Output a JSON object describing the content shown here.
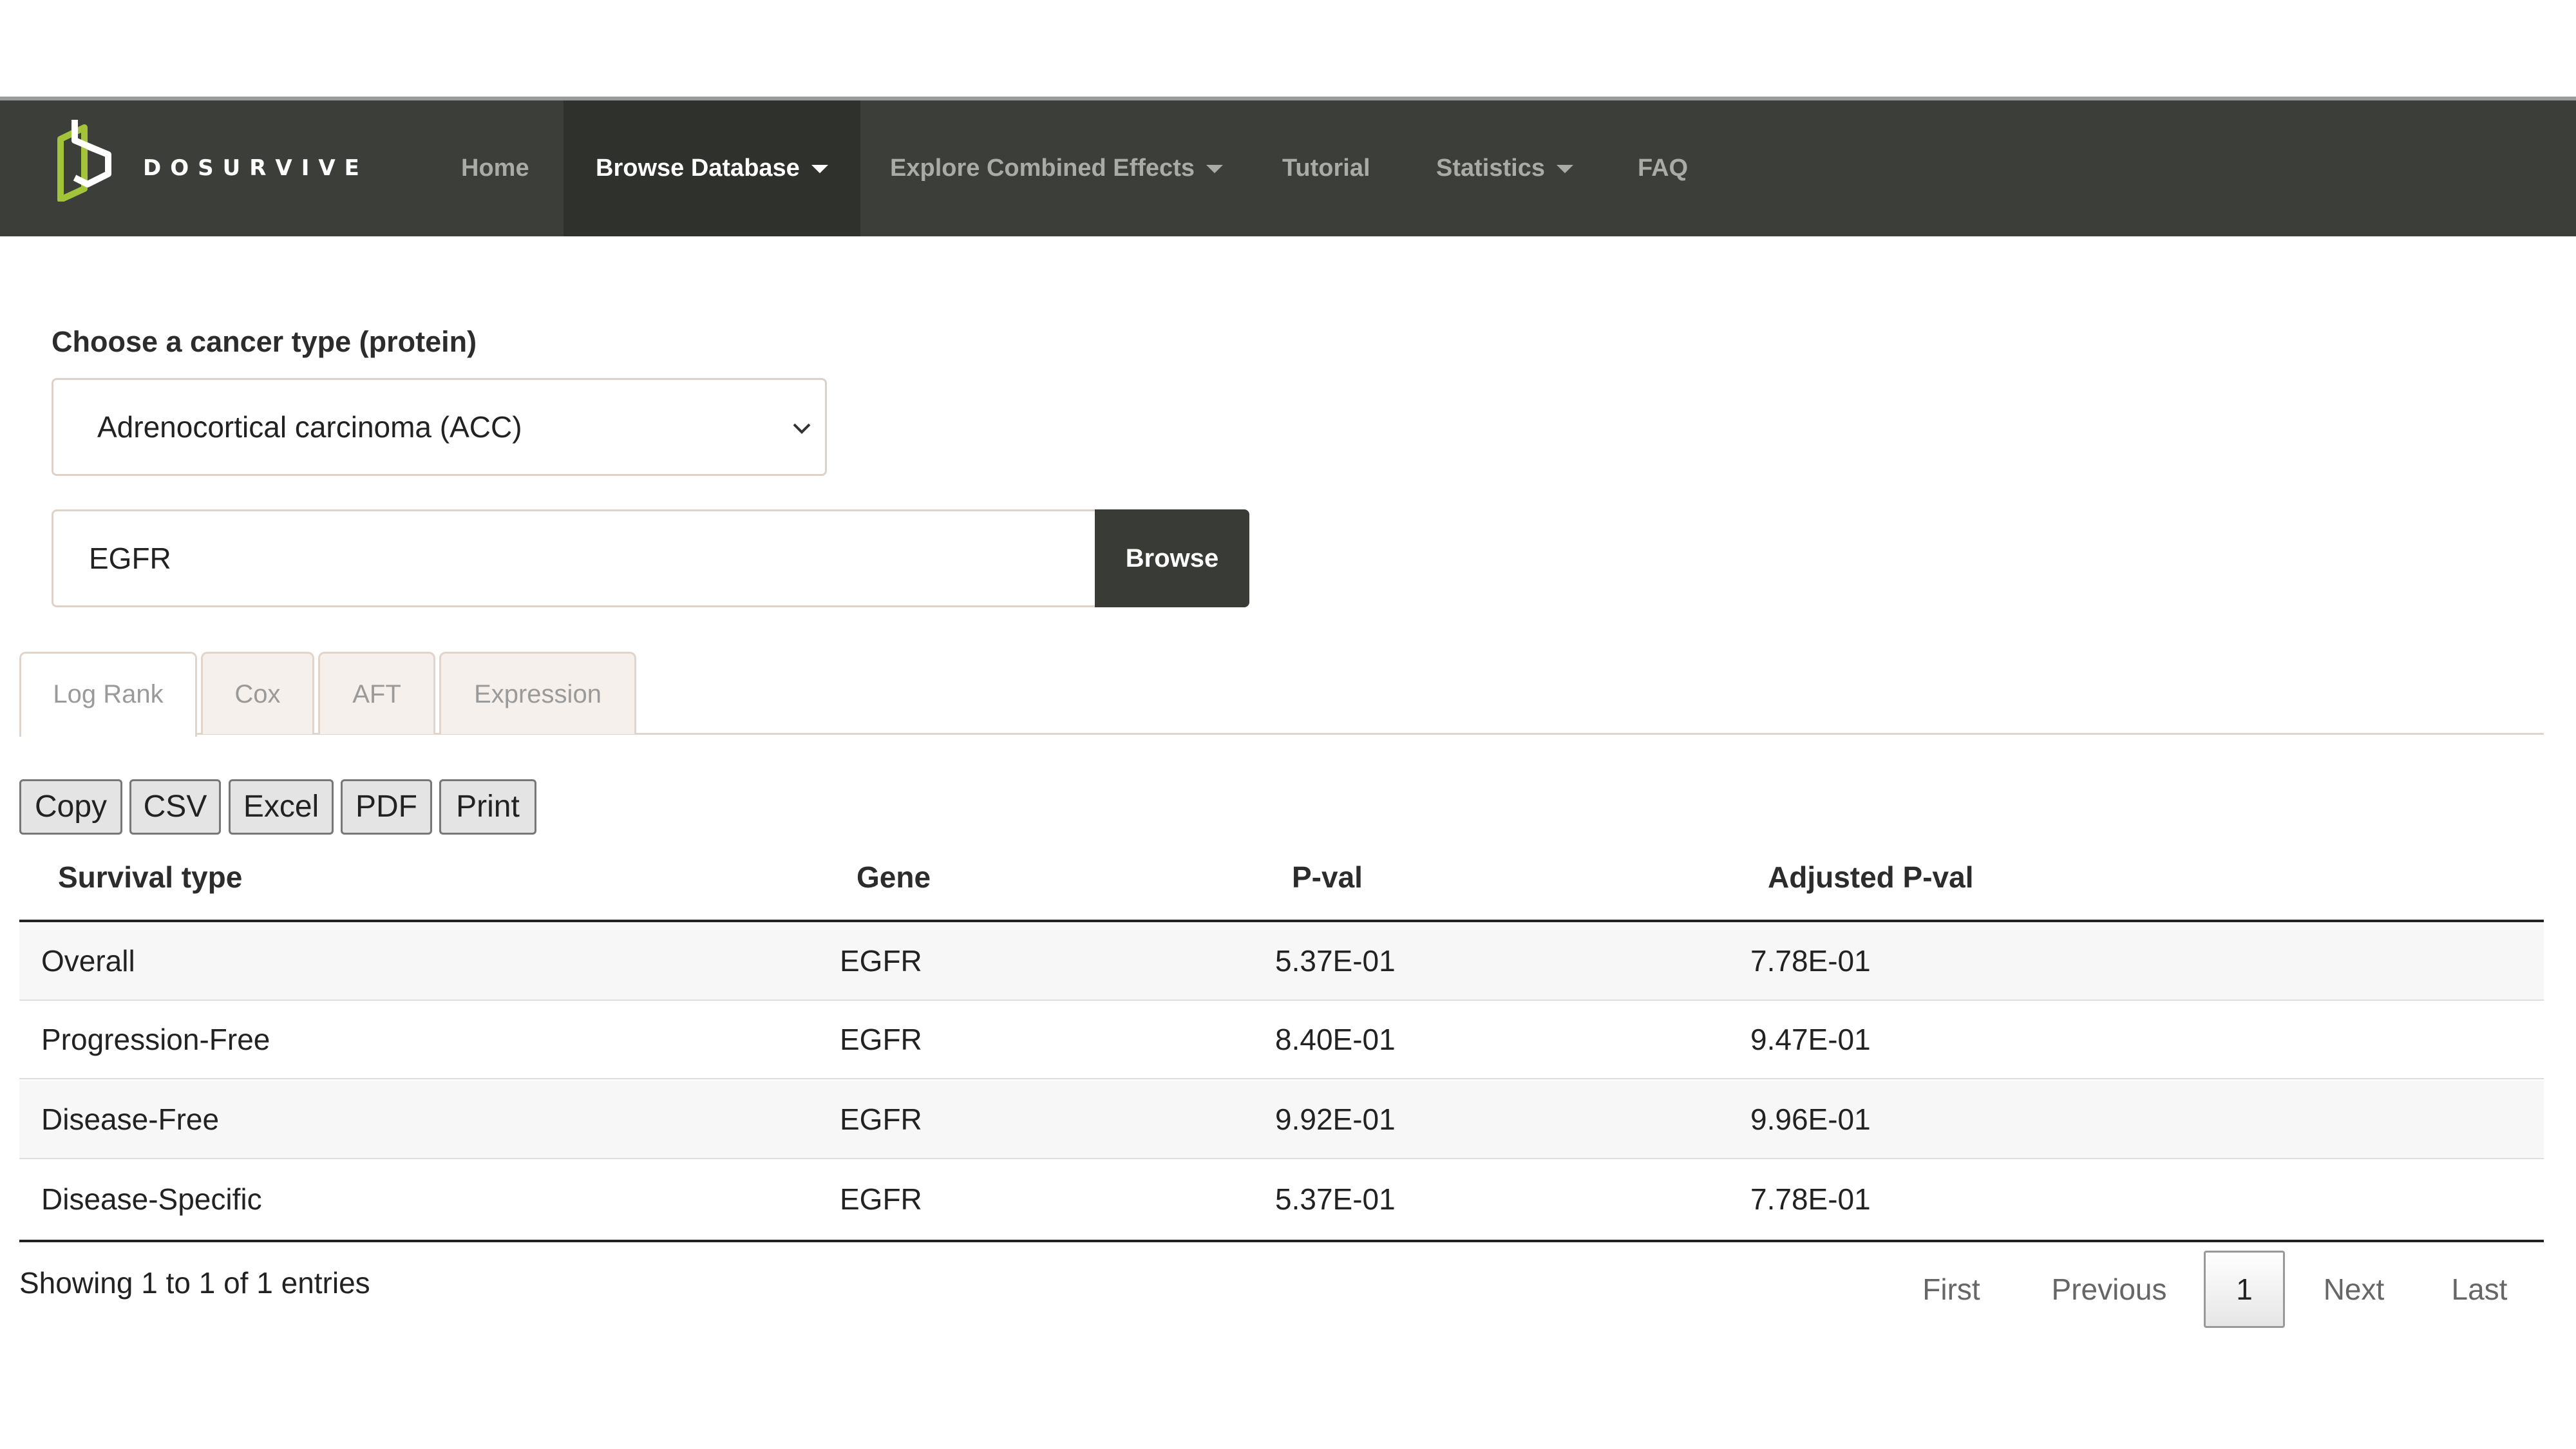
{
  "nav": {
    "brand": "DOSURVIVE",
    "items": [
      {
        "label": "Home",
        "dropdown": false
      },
      {
        "label": "Browse Database",
        "dropdown": true,
        "active": true
      },
      {
        "label": "Explore Combined Effects",
        "dropdown": true
      },
      {
        "label": "Tutorial",
        "dropdown": false
      },
      {
        "label": "Statistics",
        "dropdown": true
      },
      {
        "label": "FAQ",
        "dropdown": false
      }
    ]
  },
  "form": {
    "choose_label": "Choose a cancer type (protein)",
    "cancer_select_value": "Adrenocortical carcinoma (ACC)",
    "gene_input_value": "EGFR",
    "browse_label": "Browse"
  },
  "tabs": [
    {
      "label": "Log Rank",
      "active": true
    },
    {
      "label": "Cox"
    },
    {
      "label": "AFT"
    },
    {
      "label": "Expression"
    }
  ],
  "export_buttons": [
    "Copy",
    "CSV",
    "Excel",
    "PDF",
    "Print"
  ],
  "table": {
    "headers": [
      "Survival type",
      "Gene",
      "P-val",
      "Adjusted P-val"
    ],
    "rows": [
      [
        "Overall",
        "EGFR",
        "5.37E-01",
        "7.78E-01"
      ],
      [
        "Progression-Free",
        "EGFR",
        "8.40E-01",
        "9.47E-01"
      ],
      [
        "Disease-Free",
        "EGFR",
        "9.92E-01",
        "9.96E-01"
      ],
      [
        "Disease-Specific",
        "EGFR",
        "5.37E-01",
        "7.78E-01"
      ]
    ]
  },
  "footer": {
    "info": "Showing 1 to 1 of 1 entries",
    "pagination": {
      "first": "First",
      "previous": "Previous",
      "current": "1",
      "next": "Next",
      "last": "Last"
    }
  },
  "colors": {
    "navbar_bg": "#3b3e39",
    "logo_accent": "#a3c43a",
    "browse_button_bg": "#383b36"
  }
}
